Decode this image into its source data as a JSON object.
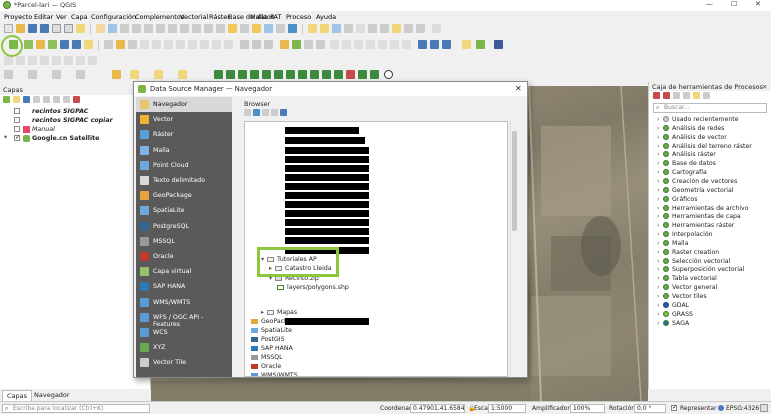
{
  "window": {
    "title": "*Parcel-lari — QGIS",
    "controls": [
      "—",
      "☐",
      "✕"
    ]
  },
  "menu": [
    "Proyecto",
    "Editar",
    "Ver",
    "Capa",
    "Configuración",
    "Complementos",
    "Vectorial",
    "Ráster",
    "Base de datos",
    "Malla",
    "PAT",
    "Proceso",
    "Ayuda"
  ],
  "layers_panel": {
    "title": "Capas",
    "items": [
      {
        "label": "recintos SIGPAC",
        "checked": false,
        "style": "bolditalic"
      },
      {
        "label": "recintos SIGPAC copiar",
        "checked": false,
        "style": "bolditalic"
      },
      {
        "label": "Manual",
        "checked": false,
        "style": "italic"
      },
      {
        "label": "Google.cn Satellite",
        "checked": true,
        "style": "bold"
      }
    ],
    "tabs": [
      "Capas",
      "Navegador"
    ]
  },
  "dialog": {
    "title": "Data Source Manager — Navegador",
    "close": "✕",
    "sidebar": [
      {
        "label": "Navegador",
        "icon": "folder-icon",
        "color": "#e9c46a"
      },
      {
        "label": "Vector",
        "icon": "vector-icon",
        "color": "#f2b233"
      },
      {
        "label": "Ráster",
        "icon": "raster-icon",
        "color": "#5aa0d8"
      },
      {
        "label": "Malla",
        "icon": "mesh-icon",
        "color": "#7fb3e6"
      },
      {
        "label": "Point Cloud",
        "icon": "pointcloud-icon",
        "color": "#6fa8dc"
      },
      {
        "label": "Texto delimitado",
        "icon": "delimited-text-icon",
        "color": "#d9d9d9"
      },
      {
        "label": "GeoPackage",
        "icon": "geopackage-icon",
        "color": "#e8a33d"
      },
      {
        "label": "SpatiaLite",
        "icon": "spatialite-icon",
        "color": "#6fa8dc"
      },
      {
        "label": "PostgreSQL",
        "icon": "postgresql-icon",
        "color": "#336791"
      },
      {
        "label": "MSSQL",
        "icon": "mssql-icon",
        "color": "#9a9a9a"
      },
      {
        "label": "Oracle",
        "icon": "oracle-icon",
        "color": "#c0392b"
      },
      {
        "label": "Capa virtual",
        "icon": "virtual-layer-icon",
        "color": "#9bc16b"
      },
      {
        "label": "SAP HANA",
        "icon": "sap-hana-icon",
        "color": "#2a7ab8"
      },
      {
        "label": "WMS/WMTS",
        "icon": "wms-icon",
        "color": "#5b9bd5"
      },
      {
        "label": "WFS / OGC API - Features",
        "icon": "wfs-icon",
        "color": "#5b9bd5"
      },
      {
        "label": "WCS",
        "icon": "wcs-icon",
        "color": "#5b9bd5"
      },
      {
        "label": "XYZ",
        "icon": "xyz-icon",
        "color": "#6aa84f"
      },
      {
        "label": "Vector Tile",
        "icon": "vector-tile-icon",
        "color": "#cccccc"
      }
    ],
    "browser": {
      "label": "Browser",
      "tree": [
        {
          "label": "Tutoriales AP",
          "kind": "folder",
          "depth": 1,
          "expanded": true
        },
        {
          "label": "Catastro Lleida",
          "kind": "folder",
          "depth": 2,
          "expanded": false
        },
        {
          "label": "Recinto.zip",
          "kind": "zip",
          "depth": 2,
          "expanded": true
        },
        {
          "label": "layers/polygons.shp",
          "kind": "shapefile",
          "depth": 3
        },
        {
          "label": "Mapas",
          "kind": "folder",
          "depth": 1,
          "expanded": false
        },
        {
          "label": "GeoPackage",
          "kind": "provider",
          "depth": 0
        },
        {
          "label": "SpatiaLite",
          "kind": "provider",
          "depth": 0
        },
        {
          "label": "PostGIS",
          "kind": "provider",
          "depth": 0
        },
        {
          "label": "SAP HANA",
          "kind": "provider",
          "depth": 0
        },
        {
          "label": "MSSQL",
          "kind": "provider",
          "depth": 0
        },
        {
          "label": "Oracle",
          "kind": "provider",
          "depth": 0
        },
        {
          "label": "WMS/WMTS",
          "kind": "provider",
          "depth": 0
        }
      ]
    }
  },
  "toolbox": {
    "title": "Caja de herramientas de Procesos",
    "search_placeholder": "Buscar...",
    "items": [
      "Usado recientemente",
      "Análisis de redes",
      "Análisis de vector",
      "Análisis del terreno ráster",
      "Análisis ráster",
      "Base de datos",
      "Cartografía",
      "Creación de vectores",
      "Geometría vectorial",
      "Gráficos",
      "Herramientas de archivo",
      "Herramientas de capa",
      "Herramientas ráster",
      "Interpolación",
      "Malla",
      "Raster creation",
      "Selección vectorial",
      "Superposición vectorial",
      "Tabla vectorial",
      "Vector general",
      "Vector tiles",
      "GDAL",
      "GRASS",
      "SAGA"
    ]
  },
  "statusbar": {
    "search_placeholder": "Escriba para localizar (Ctrl+K)",
    "coord_label": "Coordenada",
    "coord_value": "0.47901,41.65840",
    "scale_label": "Escala",
    "scale_value": "1:5000",
    "magnifier_label": "Amplificador",
    "magnifier_value": "100%",
    "rotation_label": "Rotación",
    "rotation_value": "0,0 °",
    "render_label": "Representar",
    "crs": "EPSG:4326"
  },
  "colors": {
    "highlight": "#8cc63f",
    "dialog_sidebar": "#5a5a5a",
    "selected_sidebar": "#d8d8d8"
  }
}
